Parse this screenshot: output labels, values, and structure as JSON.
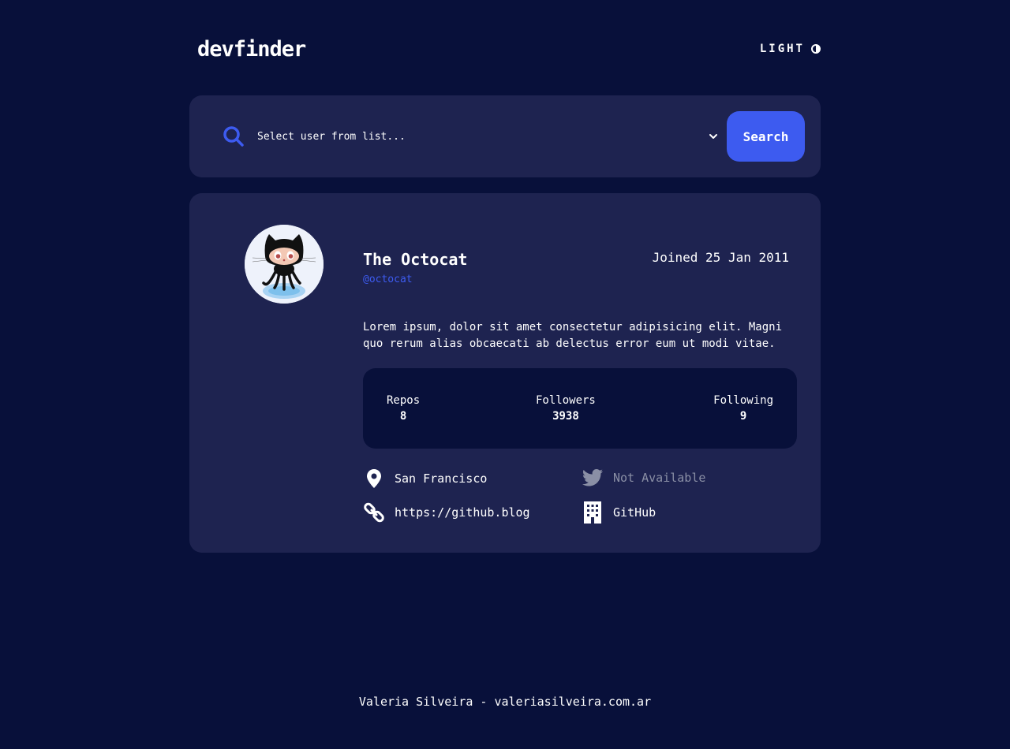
{
  "header": {
    "logo": "devfinder",
    "theme_toggle_label": "LIGHT",
    "theme_icon": "contrast-icon"
  },
  "search": {
    "select_placeholder": "Select user from list...",
    "button_label": "Search"
  },
  "profile": {
    "name": "The Octocat",
    "login": "@octocat",
    "joined": "Joined 25 Jan 2011",
    "bio": "Lorem ipsum, dolor sit amet consectetur adipisicing elit. Magni quo rerum alias obcaecati ab delectus error eum ut modi vitae.",
    "stats": {
      "repos_label": "Repos",
      "repos": "8",
      "followers_label": "Followers",
      "followers": "3938",
      "following_label": "Following",
      "following": "9"
    },
    "links": {
      "location": "San Francisco",
      "twitter": "Not Available",
      "blog": "https://github.blog",
      "company": "GitHub"
    }
  },
  "footer": {
    "credit": "Valeria Silveira - valeriasilveira.com.ar"
  },
  "colors": {
    "background": "#08103a",
    "card": "#1e2350",
    "accent": "#3d5bf0",
    "muted": "#8a8fa5"
  }
}
